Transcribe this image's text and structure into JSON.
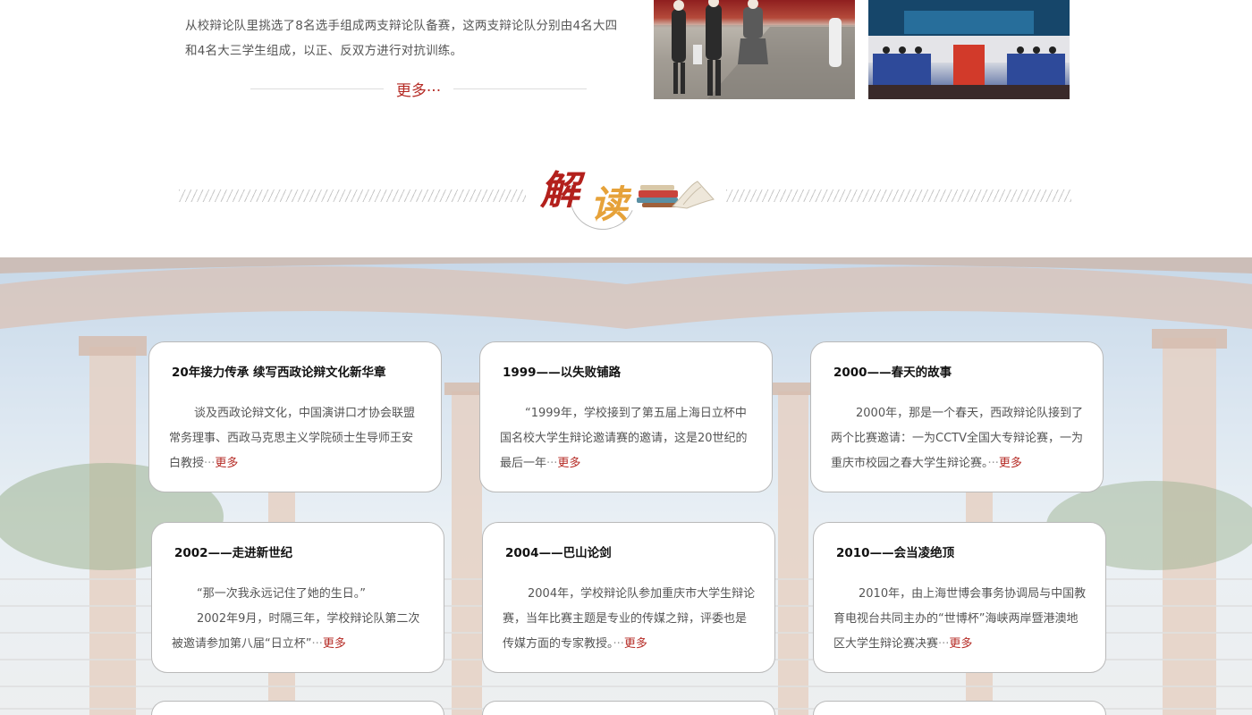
{
  "intro": {
    "line1": "从校辩论队里挑选了8名选手组成两支辩论队备赛，这两支辩论队分别由4名大四",
    "line2": "和4名大三学生组成，以正、反双方进行对抗训练。",
    "more_label": "更多···"
  },
  "section": {
    "char1": "解",
    "char2": "读",
    "title_color": "#b3201c",
    "accent_color": "#e6a23a"
  },
  "cards": [
    {
      "title": "20年接力传承 续写西政论辩文化新华章",
      "paragraphs": [
        "谈及西政论辩文化，中国演讲口才协会联盟常务理事、西政马克思主义学院硕士生导师王安白教授"
      ],
      "ellipsis": "···",
      "more": "更多"
    },
    {
      "title": "1999——以失败铺路",
      "paragraphs": [
        "“1999年，学校接到了第五届上海日立杯中国名校大学生辩论邀请赛的邀请，这是20世纪的最后一年"
      ],
      "ellipsis": "···",
      "more": "更多"
    },
    {
      "title": "2000——春天的故事",
      "paragraphs": [
        "2000年，那是一个春天，西政辩论队接到了两个比赛邀请：一为CCTV全国大专辩论赛，一为重庆市校园之春大学生辩论赛。"
      ],
      "ellipsis": "···",
      "more": "更多"
    },
    {
      "title": "2002——走进新世纪",
      "paragraphs": [
        "“那一次我永远记住了她的生日。”",
        "2002年9月，时隔三年，学校辩论队第二次被邀请参加第八届“日立杯”"
      ],
      "ellipsis": "···",
      "more": "更多"
    },
    {
      "title": "2004——巴山论剑",
      "paragraphs": [
        "2004年，学校辩论队参加重庆市大学生辩论赛，当年比赛主题是专业的传媒之辩，评委也是传媒方面的专家教授。"
      ],
      "ellipsis": "···",
      "more": "更多"
    },
    {
      "title": "2010——会当凌绝顶",
      "paragraphs": [
        "2010年，由上海世博会事务协调局与中国教育电视台共同主办的“世博杯”海峡两岸暨港澳地区大学生辩论赛决赛"
      ],
      "ellipsis": "···",
      "more": "更多"
    }
  ]
}
